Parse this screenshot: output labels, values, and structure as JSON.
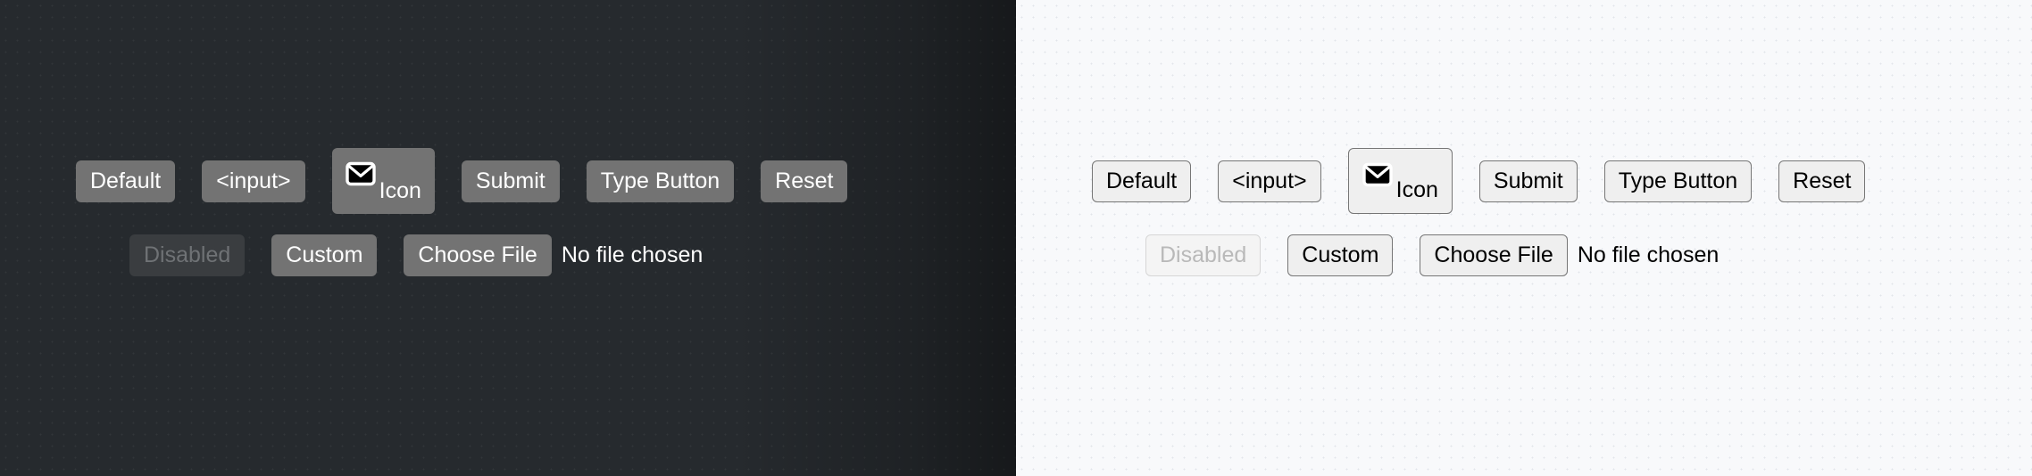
{
  "theme_colors": {
    "dark_background": "#262a2e",
    "dark_button_fill": "#737373",
    "dark_button_text": "#ffffff",
    "dark_disabled_fill": "#3a3d40",
    "dark_disabled_text": "#6f7275",
    "light_background": "#f8f9fb",
    "light_button_fill": "#efefef",
    "light_button_border": "#767676",
    "light_button_text": "#000000",
    "light_disabled_text": "#b9b9b9"
  },
  "panels": {
    "dark": {
      "row1": {
        "default_label": "Default",
        "input_label": "<input>",
        "icon_label": "Icon",
        "icon_name": "envelope-icon",
        "submit_label": "Submit",
        "type_button_label": "Type Button",
        "reset_label": "Reset"
      },
      "row2": {
        "disabled_label": "Disabled",
        "custom_label": "Custom",
        "choose_file_label": "Choose File",
        "file_status": "No file chosen"
      }
    },
    "light": {
      "row1": {
        "default_label": "Default",
        "input_label": "<input>",
        "icon_label": "Icon",
        "icon_name": "envelope-icon",
        "submit_label": "Submit",
        "type_button_label": "Type Button",
        "reset_label": "Reset"
      },
      "row2": {
        "disabled_label": "Disabled",
        "custom_label": "Custom",
        "choose_file_label": "Choose File",
        "file_status": "No file chosen"
      }
    }
  }
}
